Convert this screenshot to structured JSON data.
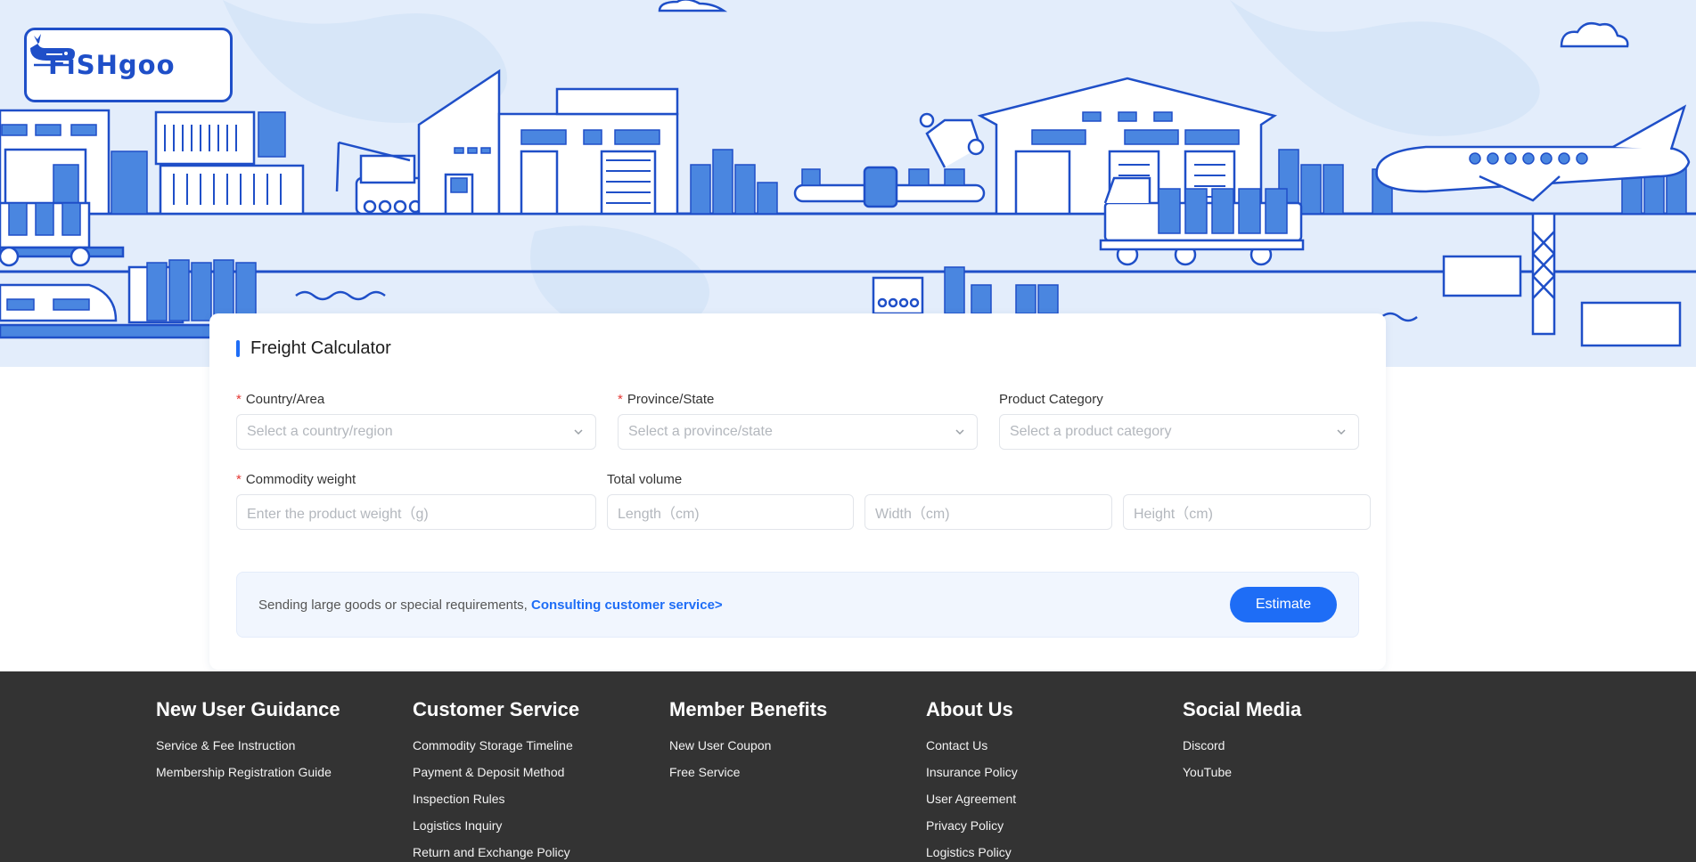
{
  "brand": {
    "name": "FiSHgoo"
  },
  "calculator": {
    "title": "Freight Calculator",
    "country": {
      "label": "Country/Area",
      "required_mark": "*",
      "placeholder": "Select a country/region"
    },
    "province": {
      "label": "Province/State",
      "required_mark": "*",
      "placeholder": "Select a province/state"
    },
    "category": {
      "label": "Product Category",
      "placeholder": "Select a product category"
    },
    "weight": {
      "label": "Commodity weight",
      "required_mark": "*",
      "placeholder": "Enter the product weight（g)"
    },
    "volume": {
      "label": "Total volume",
      "length_placeholder": "Length（cm)",
      "width_placeholder": "Width（cm)",
      "height_placeholder": "Height（cm)"
    },
    "notice": {
      "text": "Sending large goods or special requirements, ",
      "link": "Consulting customer service>"
    },
    "estimate_label": "Estimate"
  },
  "footer": {
    "columns": [
      {
        "title": "New User Guidance",
        "links": [
          "Service & Fee Instruction",
          "Membership Registration Guide"
        ]
      },
      {
        "title": "Customer Service",
        "links": [
          "Commodity Storage Timeline",
          "Payment & Deposit Method",
          "Inspection Rules",
          "Logistics Inquiry",
          "Return and Exchange Policy"
        ]
      },
      {
        "title": "Member Benefits",
        "links": [
          "New User Coupon",
          "Free Service"
        ]
      },
      {
        "title": "About Us",
        "links": [
          "Contact Us",
          "Insurance Policy",
          "User Agreement",
          "Privacy Policy",
          "Logistics Policy"
        ]
      },
      {
        "title": "Social Media",
        "links": [
          "Discord",
          "YouTube"
        ]
      }
    ]
  },
  "colors": {
    "accent": "#1e6df6",
    "brand": "#1f4fc8",
    "hero_bg": "#e3edfb",
    "footer_bg": "#333333",
    "required": "#e53935"
  },
  "icons": {
    "logo": "whale-icon",
    "dropdown": "chevron-down-icon"
  }
}
